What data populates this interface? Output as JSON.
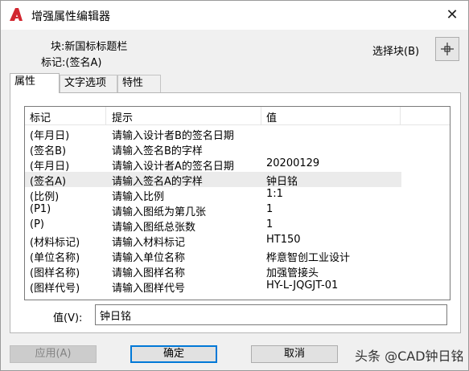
{
  "window": {
    "title": "增强属性编辑器",
    "close_glyph": "✕"
  },
  "info": {
    "block_label": "块:",
    "block_value": "新国标标题栏",
    "tag_label": "标记:",
    "tag_value": "(签名A)",
    "select_block_label": "选择块(B)"
  },
  "tabs": [
    {
      "label": "属性",
      "active": true
    },
    {
      "label": "文字选项",
      "active": false
    },
    {
      "label": "特性",
      "active": false
    }
  ],
  "table": {
    "headers": [
      "标记",
      "提示",
      "值"
    ],
    "rows": [
      {
        "tag": "(年月日)",
        "prompt": "请输入设计者B的签名日期",
        "value": ""
      },
      {
        "tag": "(签名B)",
        "prompt": "请输入签名B的字样",
        "value": ""
      },
      {
        "tag": "(年月日)",
        "prompt": "请输入设计者A的签名日期",
        "value": "20200129"
      },
      {
        "tag": "(签名A)",
        "prompt": "请输入签名A的字样",
        "value": "钟日铭",
        "selected": true
      },
      {
        "tag": "(比例)",
        "prompt": "请输入比例",
        "value": "1:1"
      },
      {
        "tag": "(P1)",
        "prompt": "请输入图纸为第几张",
        "value": "1"
      },
      {
        "tag": "(P)",
        "prompt": "请输入图纸总张数",
        "value": "1"
      },
      {
        "tag": "(材料标记)",
        "prompt": "请输入材料标记",
        "value": "HT150"
      },
      {
        "tag": "(单位名称)",
        "prompt": "请输入单位名称",
        "value": "桦意智创工业设计"
      },
      {
        "tag": "(图样名称)",
        "prompt": "请输入图样名称",
        "value": "加强管接头"
      },
      {
        "tag": "(图样代号)",
        "prompt": "请输入图样代号",
        "value": "HY-L-JQGJT-01"
      }
    ]
  },
  "value_field": {
    "label": "值(V):",
    "value": "钟日铭"
  },
  "buttons": {
    "apply": "应用(A)",
    "ok": "确定",
    "cancel": "取消"
  },
  "watermark": "头条 @CAD钟日铭",
  "colors": {
    "accent": "#0078d7",
    "autocad_red": "#d22630",
    "selected_row": "#ebebeb"
  }
}
